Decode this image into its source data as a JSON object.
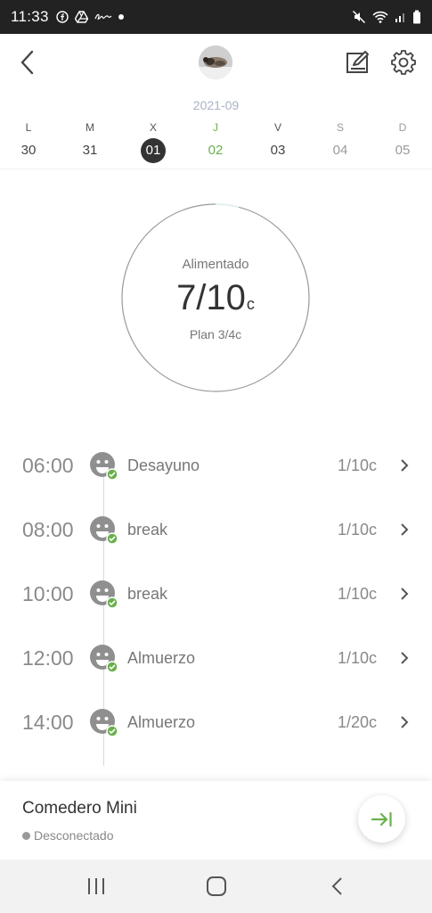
{
  "status_bar": {
    "time": "11:33",
    "left_icons": [
      "facebook-icon",
      "drive-icon",
      "signature-icon",
      "dot-icon"
    ],
    "right_icons": [
      "mute-icon",
      "wifi-icon",
      "signal-icon",
      "battery-icon"
    ]
  },
  "header": {
    "back_icon": "back-arrow-icon",
    "avatar": "pet-avatar",
    "edit_icon": "edit-icon",
    "settings_icon": "gear-icon"
  },
  "calendar": {
    "month": "2021-09",
    "days": [
      {
        "letter": "L",
        "num": "30"
      },
      {
        "letter": "M",
        "num": "31"
      },
      {
        "letter": "X",
        "num": "01"
      },
      {
        "letter": "J",
        "num": "02"
      },
      {
        "letter": "V",
        "num": "03"
      },
      {
        "letter": "S",
        "num": "04"
      },
      {
        "letter": "D",
        "num": "05"
      }
    ],
    "selected_index": 2,
    "today_index": 3
  },
  "summary": {
    "label": "Alimentado",
    "fed": "7/10",
    "unit": "c",
    "plan": "Plan 3/4c",
    "progress_fraction": 0.04
  },
  "feedings": [
    {
      "time": "06:00",
      "name": "Desayuno",
      "amount": "1/10c"
    },
    {
      "time": "08:00",
      "name": "break",
      "amount": "1/10c"
    },
    {
      "time": "10:00",
      "name": "break",
      "amount": "1/10c"
    },
    {
      "time": "12:00",
      "name": "Almuerzo",
      "amount": "1/10c"
    },
    {
      "time": "14:00",
      "name": "Almuerzo",
      "amount": "1/20c"
    }
  ],
  "device": {
    "name": "Comedero Mini",
    "status": "Desconectado"
  },
  "colors": {
    "accent_green": "#6ab04c",
    "status_bar": "#222222",
    "ring": "#9a9a9a"
  }
}
